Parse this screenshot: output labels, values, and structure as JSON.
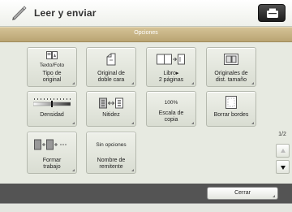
{
  "header": {
    "title": "Leer y enviar"
  },
  "options_bar": {
    "title": "Opciones"
  },
  "tiles": [
    {
      "icon": "original-type-icon",
      "icon_text": "Texto/Foto",
      "label_1": "Tipo de",
      "label_2": "original"
    },
    {
      "icon": "two-sided-original-icon",
      "label_1": "Original de",
      "label_2": "doble cara"
    },
    {
      "icon": "book-to-two-pages-icon",
      "label_1": "Libro▸",
      "label_2": "2 páginas"
    },
    {
      "icon": "different-size-originals-icon",
      "label_1": "Originales de",
      "label_2": "dist. tamaño"
    },
    {
      "icon": "density-slider-icon",
      "label_1": "Densidad",
      "label_2": ""
    },
    {
      "icon": "sharpness-icon",
      "label_1": "Nitidez",
      "label_2": ""
    },
    {
      "icon_text": "100%",
      "label_1": "Escala de",
      "label_2": "copia"
    },
    {
      "icon": "erase-frame-icon",
      "label_1": "Borrar bordes",
      "label_2": ""
    },
    {
      "icon": "job-build-icon",
      "label_1": "Formar",
      "label_2": "trabajo"
    },
    {
      "icon_text": "Sin opciones",
      "label_1": "Nombre de",
      "label_2": "remitente"
    }
  ],
  "pagination": {
    "page": "1/2"
  },
  "footer": {
    "close_label": "Cerrar"
  },
  "colors": {
    "options_bar": "#c4b083",
    "footer": "#545454",
    "tile": "#e2e5dc"
  }
}
